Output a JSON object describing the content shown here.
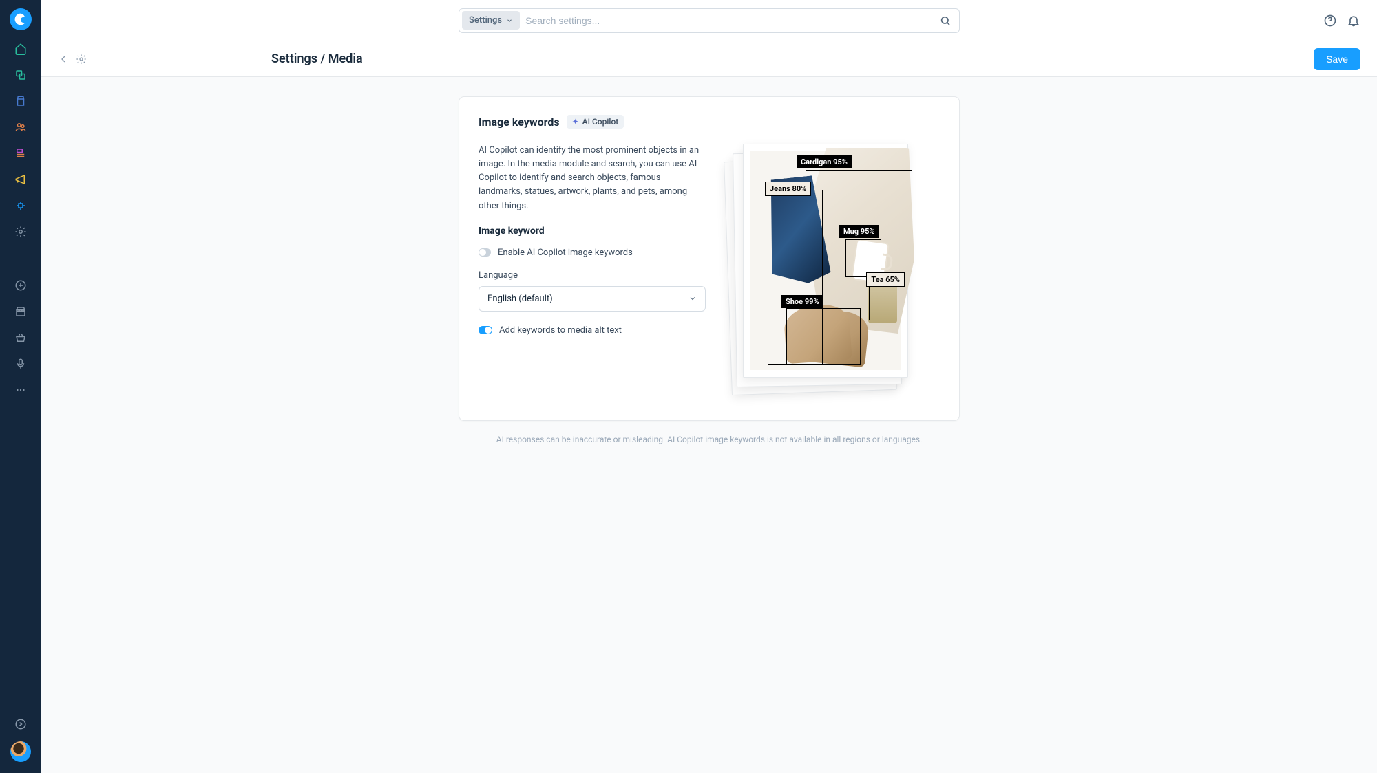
{
  "search": {
    "scope_label": "Settings",
    "placeholder": "Search settings..."
  },
  "breadcrumb": "Settings / Media",
  "save_label": "Save",
  "card": {
    "title": "Image keywords",
    "badge": "AI Copilot",
    "description": "AI Copilot can identify the most prominent objects in an image. In the media module and search, you can use AI Copilot to identify and search objects, famous landmarks, statues, artwork, plants, and pets, among other things.",
    "subhead": "Image keyword",
    "enable_label": "Enable AI Copilot image keywords",
    "language_label": "Language",
    "language_value": "English (default)",
    "alt_text_label": "Add keywords to media alt text"
  },
  "detections": {
    "cardigan": "Cardigan 95%",
    "jeans": "Jeans 80%",
    "mug": "Mug 95%",
    "tea": "Tea 65%",
    "shoe": "Shoe 99%"
  },
  "disclaimer": "AI responses can be inaccurate or misleading. AI Copilot image keywords is not available in all regions or languages."
}
